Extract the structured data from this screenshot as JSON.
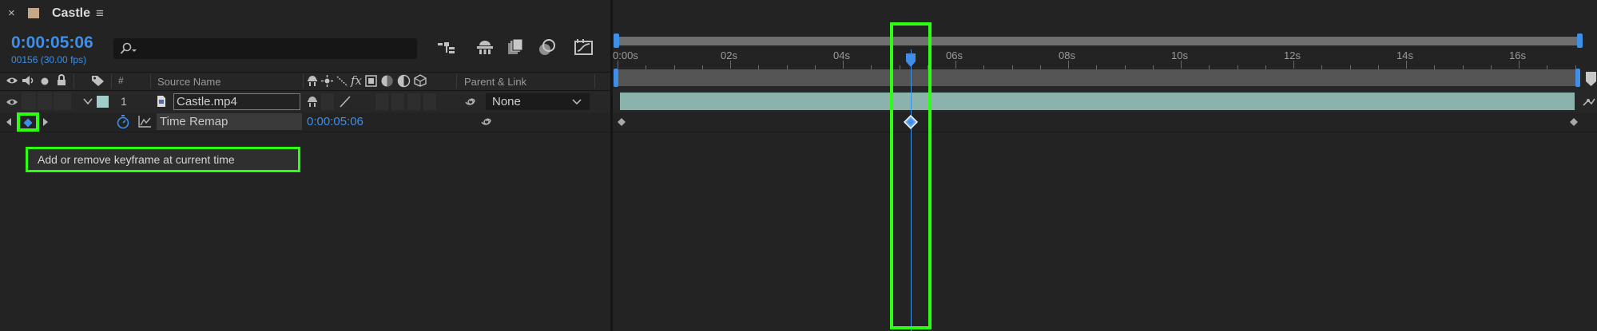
{
  "tab": {
    "title": "Castle",
    "close": "×",
    "menu": "≡",
    "color": "#c4a789"
  },
  "timecode": {
    "value": "0:00:05:06",
    "frames": "00156 (30.00 fps)"
  },
  "search": {
    "placeholder": ""
  },
  "columns": {
    "number": "#",
    "source_name": "Source Name",
    "parent_link": "Parent & Link"
  },
  "layer": {
    "number": "1",
    "name": "Castle.mp4",
    "parent": "None",
    "label_color": "#9fcfc7"
  },
  "property": {
    "name": "Time Remap",
    "value": "0:00:05:06"
  },
  "tooltip": {
    "text": "Add or remove keyframe at current time"
  },
  "ruler": {
    "ticks": [
      "0:00s",
      "02s",
      "04s",
      "06s",
      "08s",
      "10s",
      "12s",
      "14s",
      "16s"
    ]
  },
  "playhead": {
    "time_seconds": 5.2
  },
  "colors": {
    "accent": "#3f8ee8",
    "highlight": "#2dff12",
    "layer_bar": "#8ab3ac"
  }
}
